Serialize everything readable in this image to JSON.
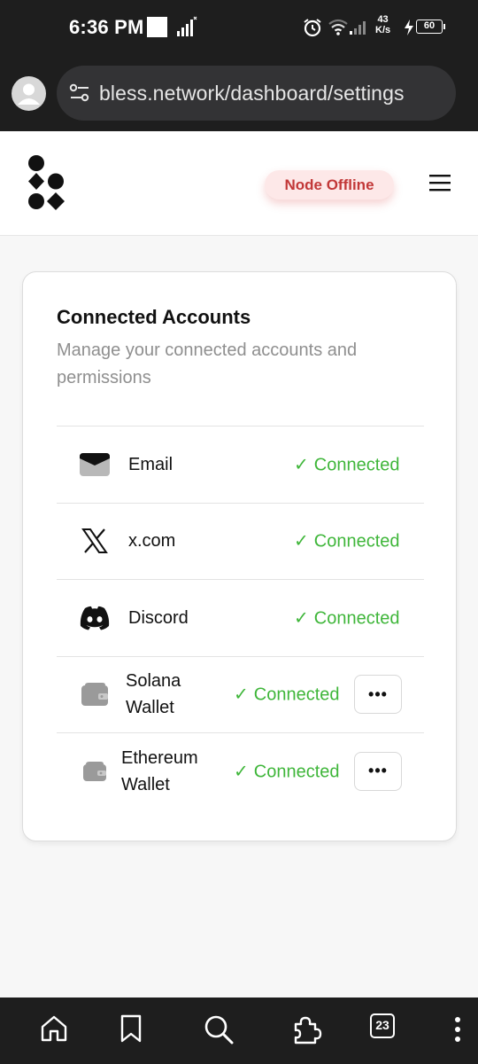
{
  "status_bar": {
    "time": "6:36 PM",
    "net_speed_value": "43",
    "net_speed_unit": "K/s",
    "battery": "60",
    "icons": [
      "alarm-icon",
      "wifi-icon",
      "cell-signal-icon",
      "charging-icon"
    ]
  },
  "browser": {
    "url": "bless.network/dashboard/settings",
    "tab_count": "23"
  },
  "header": {
    "node_status": "Node Offline",
    "node_status_color": "#c23838"
  },
  "card": {
    "title": "Connected Accounts",
    "subtitle": "Manage your connected accounts and permissions",
    "accounts": [
      {
        "name": "Email",
        "status": "Connected",
        "icon": "email-icon"
      },
      {
        "name": "x.com",
        "status": "Connected",
        "icon": "x-logo-icon"
      },
      {
        "name": "Discord",
        "status": "Connected",
        "icon": "discord-icon"
      },
      {
        "name": "Solana Wallet",
        "status": "Connected",
        "icon": "wallet-icon",
        "more": "•••"
      },
      {
        "name": "Ethereum Wallet",
        "status": "Connected",
        "icon": "wallet-icon",
        "more": "•••"
      }
    ],
    "check_glyph": "✓",
    "status_color": "#3fb63a"
  },
  "bottom_nav": [
    "home-icon",
    "bookmark-icon",
    "search-icon",
    "extensions-icon",
    "tabs-icon",
    "more-vert-icon"
  ]
}
